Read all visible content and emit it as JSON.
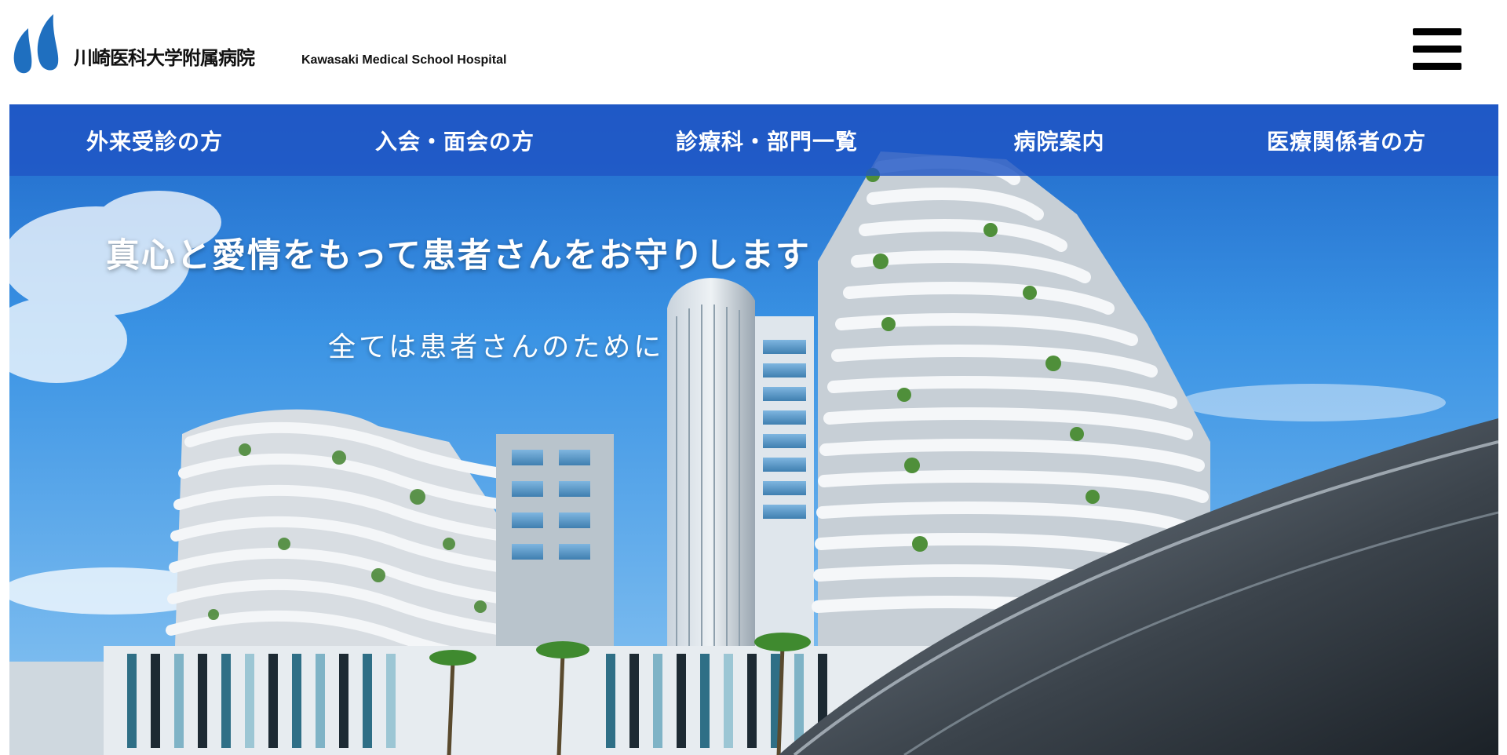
{
  "header": {
    "logo": {
      "name_ja": "川崎医科大学附属病院",
      "name_en": "Kawasaki Medical School Hospital",
      "mark_icon": "hospital-logo-mark",
      "mark_color": "#1f6fbf"
    },
    "menu_icon": "hamburger-menu-icon"
  },
  "nav": {
    "background": "#2056c4",
    "items": [
      {
        "label": "外来受診の方"
      },
      {
        "label": "入会・面会の方"
      },
      {
        "label": "診療科・部門一覧"
      },
      {
        "label": "病院案内"
      },
      {
        "label": "医療関係者の方"
      }
    ]
  },
  "hero": {
    "title": "真心と愛情をもって患者さんをお守りします",
    "subtitle": "全ては患者さんのために",
    "image": "hospital-building-photo",
    "sky_color": "#3f9be6"
  }
}
